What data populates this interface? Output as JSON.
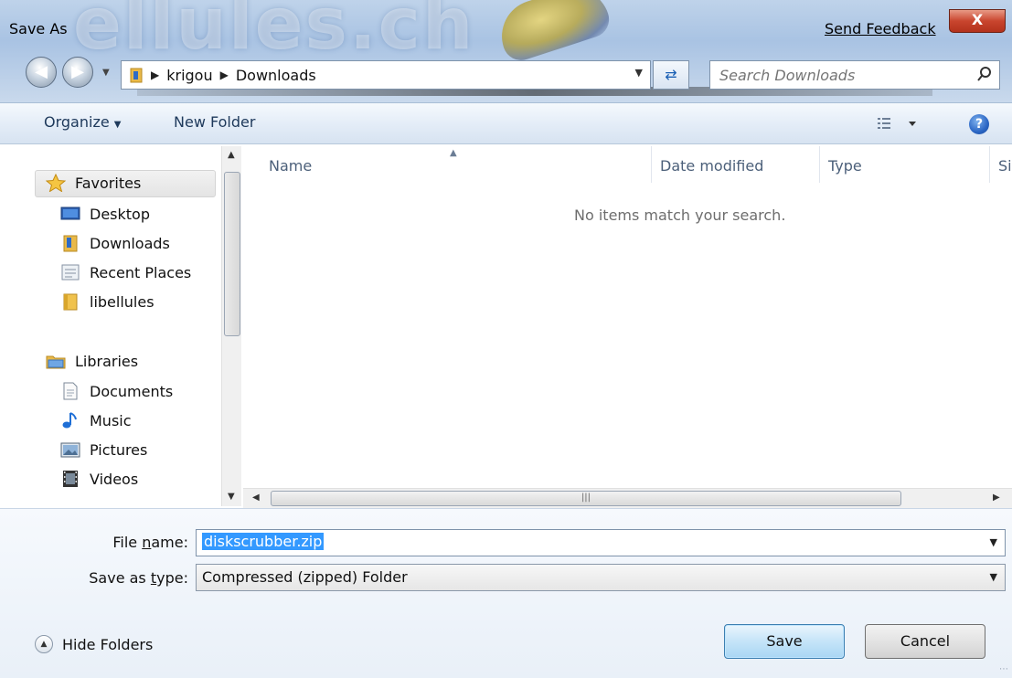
{
  "window": {
    "title": "Save As",
    "send_feedback": "Send Feedback",
    "close_label": "X"
  },
  "address": {
    "crumbs": [
      "krigou",
      "Downloads"
    ]
  },
  "search": {
    "placeholder": "Search Downloads"
  },
  "toolbar": {
    "organize": "Organize",
    "new_folder": "New Folder"
  },
  "nav_pane": {
    "favorites": {
      "label": "Favorites",
      "items": [
        {
          "label": "Desktop",
          "icon": "desktop-icon"
        },
        {
          "label": "Downloads",
          "icon": "downloads-folder-icon"
        },
        {
          "label": "Recent Places",
          "icon": "recent-places-icon"
        },
        {
          "label": "libellules",
          "icon": "folder-icon"
        }
      ]
    },
    "libraries": {
      "label": "Libraries",
      "items": [
        {
          "label": "Documents",
          "icon": "documents-icon"
        },
        {
          "label": "Music",
          "icon": "music-icon"
        },
        {
          "label": "Pictures",
          "icon": "pictures-icon"
        },
        {
          "label": "Videos",
          "icon": "videos-icon"
        }
      ]
    }
  },
  "file_list": {
    "columns": [
      "Name",
      "Date modified",
      "Type",
      "Si"
    ],
    "empty_message": "No items match your search."
  },
  "bottom": {
    "file_name_label_pre": "File ",
    "file_name_label_key": "n",
    "file_name_label_post": "ame:",
    "file_name_value": "diskscrubber.zip",
    "save_type_label_pre": "Save as ",
    "save_type_label_key": "t",
    "save_type_label_post": "ype:",
    "save_type_value": "Compressed (zipped) Folder",
    "hide_folders": "Hide Folders",
    "save_button": "Save",
    "cancel_button": "Cancel"
  },
  "colors": {
    "glass": "#bfd3ea",
    "selection": "#3399ff",
    "close_red": "#c9452e",
    "command_text": "#1e395b"
  }
}
